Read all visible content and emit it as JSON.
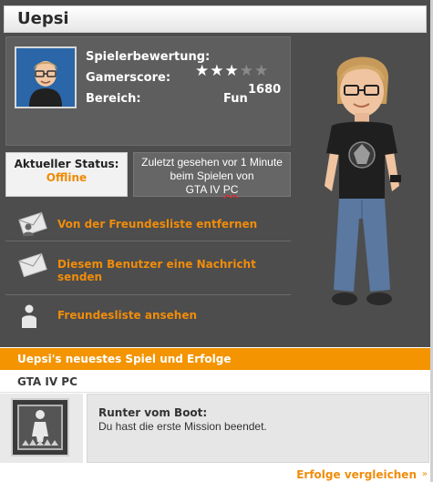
{
  "profile": {
    "gamertag": "Uepsi",
    "labels": {
      "rating": "Spielerbewertung:",
      "gamerscore": "Gamerscore:",
      "zone": "Bereich:"
    },
    "rating_stars": 3,
    "rating_max": 5,
    "gamerscore": "1680",
    "zone": "Fun"
  },
  "status": {
    "title": "Aktueller Status:",
    "value": "Offline",
    "last_seen": "Zuletzt gesehen vor 1 Minute beim Spielen von",
    "last_seen_game_prefix": "GTA IV ",
    "last_seen_game_suffix": "PC"
  },
  "actions": {
    "remove_friend": "Von der Freundesliste entfernen",
    "send_message": "Diesem Benutzer eine Nachricht senden",
    "view_friends": "Freundesliste ansehen"
  },
  "latest_game": {
    "header": "Uepsi's neuestes Spiel und Erfolge",
    "game_name": "GTA IV PC",
    "achievement_title": "Runter vom Boot:",
    "achievement_desc": "Du hast die erste Mission beendet."
  },
  "footer": {
    "compare_link": "Erfolge vergleichen",
    "arrow_icon": "»"
  },
  "colors": {
    "accent_orange": "#f39400",
    "link_orange": "#f08c0a",
    "dark_panel": "#4d4d4d"
  },
  "icons": [
    "remove-friend-icon",
    "message-envelope-icon",
    "person-silhouette-icon",
    "achievement-icon"
  ]
}
